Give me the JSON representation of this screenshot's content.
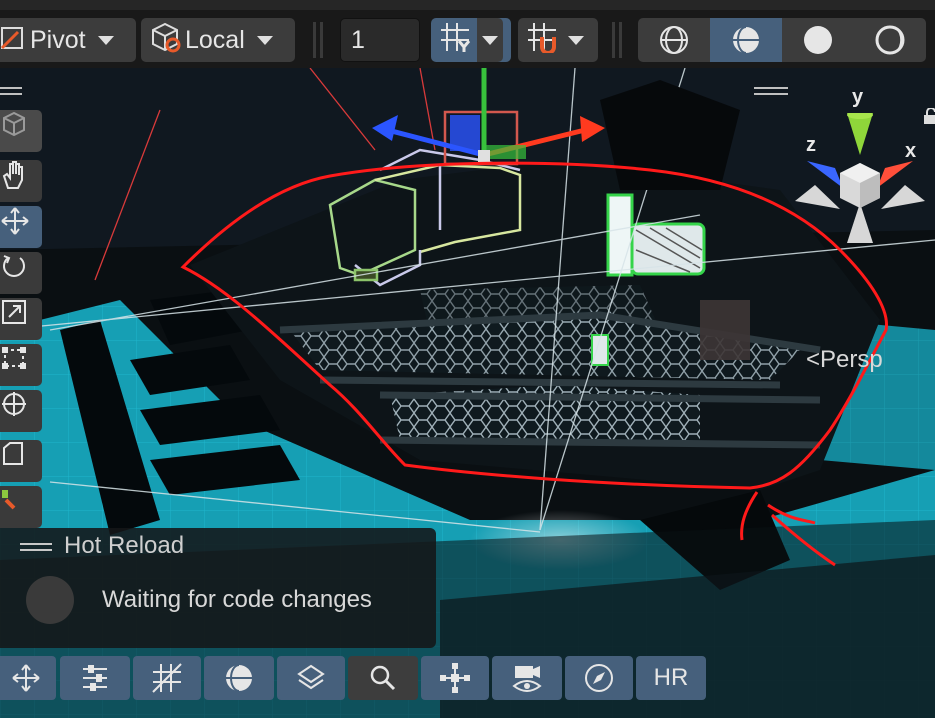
{
  "toolbar": {
    "pivot_label": "Pivot",
    "local_label": "Local",
    "snap_value": "1",
    "icons": [
      "pivot-icon",
      "local-cube-icon",
      "grid-snap-icon",
      "snap-magnet-icon",
      "shading-wireframe-icon",
      "shading-shaded-icon",
      "shading-unlit-icon",
      "shading-lit-icon"
    ]
  },
  "tools": [
    "view-cube-icon",
    "hand-icon",
    "move-icon",
    "rotate-icon",
    "scale-icon",
    "rect-icon",
    "transform-icon",
    "custom-tool-icon",
    "custom-color-tool-icon"
  ],
  "gizmo": {
    "y": "y",
    "x": "x",
    "z": "z",
    "projection": "Persp"
  },
  "hot_reload": {
    "title": "Hot Reload",
    "status": "Waiting for code changes"
  },
  "bottom_toolbar": {
    "icons": [
      "move-icon",
      "sliders-icon",
      "grid-icon",
      "sphere-icon",
      "layers-icon",
      "search-icon",
      "scale-nodes-icon",
      "camera-eye-icon",
      "compass-icon"
    ],
    "hr_label": "HR"
  },
  "colors": {
    "accent": "#46607c",
    "annotation": "#ff1a1a",
    "floor": "#17a3b8"
  }
}
